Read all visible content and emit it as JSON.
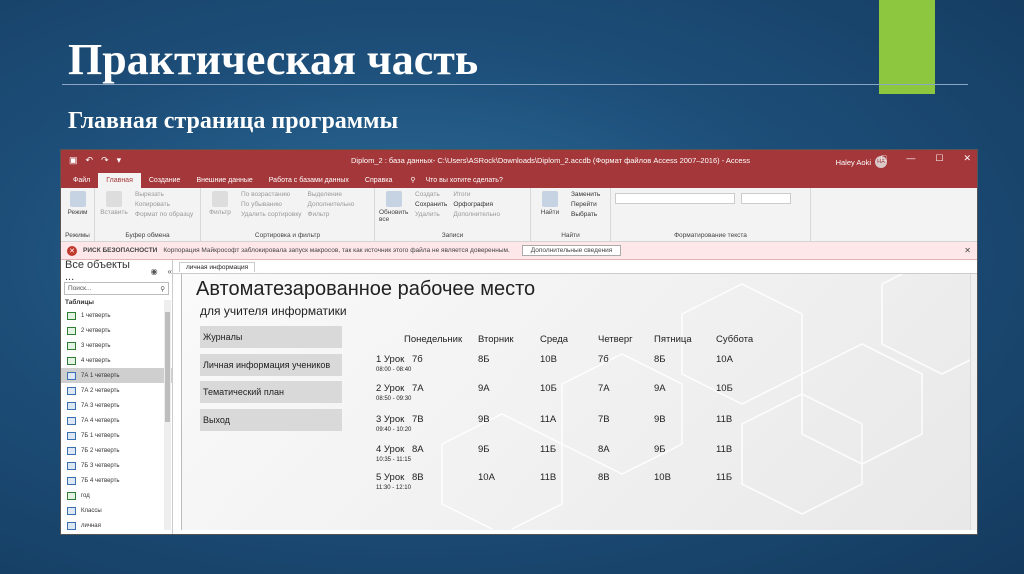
{
  "slide": {
    "title": "Практическая часть",
    "subtitle": "Главная страница программы",
    "accent_color": "#8dc63f"
  },
  "app": {
    "window_title": "Diplom_2 : база данных- C:\\Users\\ASRock\\Downloads\\Diplom_2.accdb (Формат файлов Access 2007–2016) - Access",
    "user_name": "Haley Aoki",
    "user_initials": "HA",
    "tabs": [
      "Файл",
      "Главная",
      "Создание",
      "Внешние данные",
      "Работа с базами данных",
      "Справка"
    ],
    "active_tab": "Главная",
    "tell_me": "Что вы хотите сделать?",
    "ribbon": {
      "views": {
        "button": "Режим",
        "label": "Режимы"
      },
      "clipboard": {
        "paste": "Вставить",
        "cut": "Вырезать",
        "copy": "Копировать",
        "format_painter": "Формат по образцу",
        "label": "Буфер обмена"
      },
      "sort_filter": {
        "filter": "Фильтр",
        "ascending": "По возрастанию",
        "descending": "По убыванию",
        "remove_sort": "Удалить сортировку",
        "selection": "Выделение",
        "advanced": "Дополнительно",
        "toggle_filter": "Фильтр",
        "label": "Сортировка и фильтр"
      },
      "records": {
        "refresh": "Обновить все",
        "new": "Создать",
        "save": "Сохранить",
        "delete": "Удалить",
        "totals": "Итоги",
        "spelling": "Орфография",
        "more": "Дополнительно",
        "label": "Записи"
      },
      "find": {
        "find": "Найти",
        "replace": "Заменить",
        "goto": "Перейти",
        "select": "Выбрать",
        "label": "Найти"
      },
      "text_formatting": {
        "label": "Форматирование текста"
      }
    },
    "security_bar": {
      "title": "РИСК БЕЗОПАСНОСТИ",
      "message": "Корпорация Майкрософт заблокировала запуск макросов, так как источник этого файла не является доверенным.",
      "button": "Дополнительные сведения"
    },
    "nav_pane": {
      "header": "Все объекты ...",
      "search_placeholder": "Поиск...",
      "section": "Таблицы",
      "items": [
        {
          "label": "1 четверть",
          "type": "linked"
        },
        {
          "label": "2 четверть",
          "type": "linked"
        },
        {
          "label": "3 четверть",
          "type": "linked"
        },
        {
          "label": "4 четверть",
          "type": "linked"
        },
        {
          "label": "7А 1 четверть",
          "type": "table",
          "selected": true
        },
        {
          "label": "7А 2 четверть",
          "type": "table"
        },
        {
          "label": "7А 3 четверть",
          "type": "table"
        },
        {
          "label": "7А 4 четверть",
          "type": "table"
        },
        {
          "label": "7Б 1 четверть",
          "type": "table"
        },
        {
          "label": "7Б 2 четверть",
          "type": "table"
        },
        {
          "label": "7Б 3 четверть",
          "type": "table"
        },
        {
          "label": "7Б 4 четверть",
          "type": "table"
        },
        {
          "label": "год",
          "type": "linked"
        },
        {
          "label": "Классы",
          "type": "table"
        },
        {
          "label": "личная",
          "type": "table"
        }
      ]
    },
    "document_tab": "личная информация",
    "form": {
      "title": "Автоматезарованное рабочее место",
      "subtitle": "для учителя информатики",
      "menu": [
        "Журналы",
        "Личная информация учеников",
        "Тематический план",
        "Выход"
      ],
      "days": [
        "Понедельник",
        "Вторник",
        "Среда",
        "Четверг",
        "Пятница",
        "Суббота"
      ],
      "lessons": [
        {
          "name": "1 Урок",
          "time": "08:00 - 08:40",
          "classes": [
            "7б",
            "8Б",
            "10В",
            "7б",
            "8Б",
            "10А"
          ]
        },
        {
          "name": "2 Урок",
          "time": "08:50 - 09:30",
          "classes": [
            "7А",
            "9А",
            "10Б",
            "7А",
            "9А",
            "10Б"
          ]
        },
        {
          "name": "3 Урок",
          "time": "09:40 - 10:20",
          "classes": [
            "7В",
            "9В",
            "11А",
            "7В",
            "9В",
            "11В"
          ]
        },
        {
          "name": "4 Урок",
          "time": "10:35 - 11:15",
          "classes": [
            "8А",
            "9Б",
            "11Б",
            "8А",
            "9Б",
            "11В"
          ]
        },
        {
          "name": "5 Урок",
          "time": "11:30 - 12:10",
          "classes": [
            "8В",
            "10А",
            "11В",
            "8В",
            "10В",
            "11Б"
          ]
        }
      ]
    }
  }
}
